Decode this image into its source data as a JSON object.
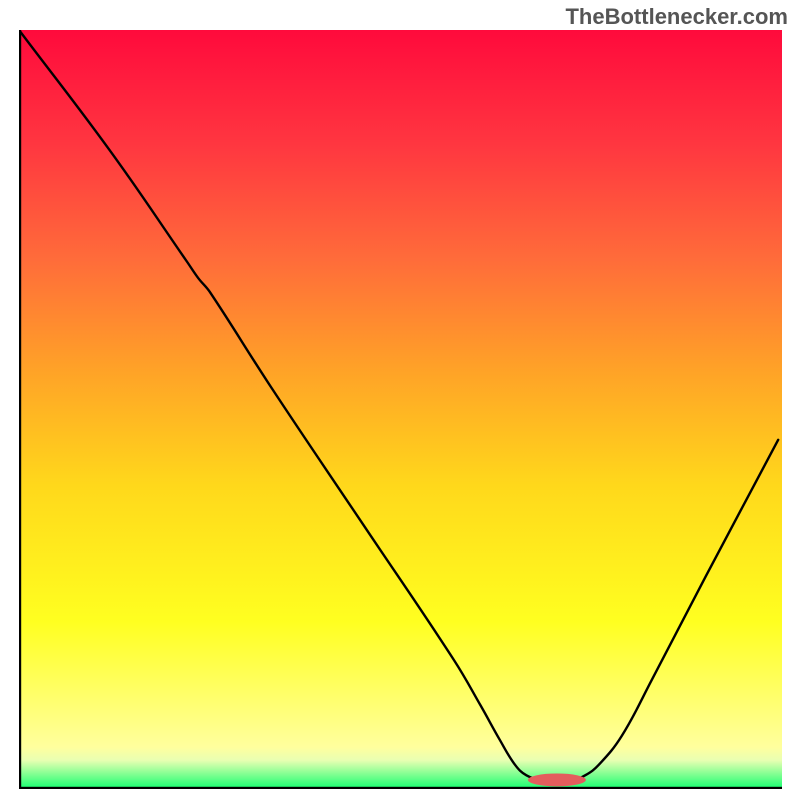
{
  "watermark": "TheBottlenecker.com",
  "chart_data": {
    "type": "line",
    "title": "",
    "xlabel": "",
    "ylabel": "",
    "xlim": [
      0,
      100
    ],
    "ylim": [
      0,
      100
    ],
    "background_gradient": {
      "type": "linear-vertical",
      "main": [
        {
          "stop": 0,
          "color": "#ff0a3c"
        },
        {
          "stop": 0.15,
          "color": "#ff3640"
        },
        {
          "stop": 0.3,
          "color": "#ff6b3a"
        },
        {
          "stop": 0.45,
          "color": "#ffa327"
        },
        {
          "stop": 0.6,
          "color": "#ffd81b"
        },
        {
          "stop": 0.78,
          "color": "#ffff20"
        },
        {
          "stop": 0.945,
          "color": "#ffff9e"
        },
        {
          "stop": 0.962,
          "color": "#e9ffb2"
        },
        {
          "stop": 0.998,
          "color": "#1fff73"
        },
        {
          "stop": 1.0,
          "color": "#0cff72"
        }
      ],
      "band_start_y": 0.78
    },
    "curve": {
      "comment": "x,y in percent of plot area, y measured from top (0=top,100=bottom)",
      "points": [
        [
          0,
          0
        ],
        [
          12,
          16
        ],
        [
          22,
          30.5
        ],
        [
          23.5,
          32.7
        ],
        [
          25,
          34.5
        ],
        [
          33,
          47
        ],
        [
          45,
          65
        ],
        [
          57,
          83
        ],
        [
          60.5,
          89
        ],
        [
          63,
          93.5
        ],
        [
          65,
          96.8
        ],
        [
          66.5,
          98.2
        ],
        [
          68.5,
          98.8
        ],
        [
          72.5,
          98.8
        ],
        [
          74.2,
          98.2
        ],
        [
          76,
          96.8
        ],
        [
          79,
          93
        ],
        [
          83,
          85.5
        ],
        [
          90,
          72
        ],
        [
          99.5,
          54
        ]
      ]
    },
    "marker": {
      "cx_pct": 70.5,
      "cy_pct": 98.8,
      "rx_pct": 3.8,
      "ry_pct": 0.85,
      "fill": "#e45d5d"
    }
  }
}
